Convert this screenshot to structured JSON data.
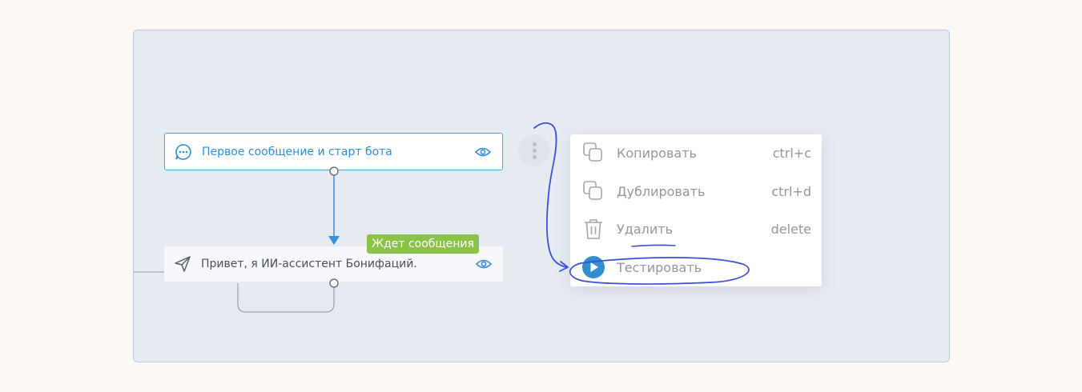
{
  "nodes": {
    "first": {
      "label": "Первое сообщение и старт бота",
      "icon": "chat-bubble-icon"
    },
    "second": {
      "label": "Привет, я ИИ-ассистент Бонифаций.",
      "icon": "send-icon",
      "badge": "Ждет сообщения"
    }
  },
  "context_menu": {
    "items": [
      {
        "label": "Копировать",
        "shortcut": "ctrl+c",
        "icon": "copy-icon"
      },
      {
        "label": "Дублировать",
        "shortcut": "ctrl+d",
        "icon": "duplicate-icon"
      },
      {
        "label": "Удалить",
        "shortcut": "delete",
        "icon": "trash-icon"
      },
      {
        "label": "Тестировать",
        "shortcut": "",
        "icon": "play-icon"
      }
    ]
  },
  "colors": {
    "accent": "#2f8fd0",
    "badge": "#8bc34a",
    "annotation": "#3b4fd6",
    "canvas": "#e6eaf1"
  }
}
